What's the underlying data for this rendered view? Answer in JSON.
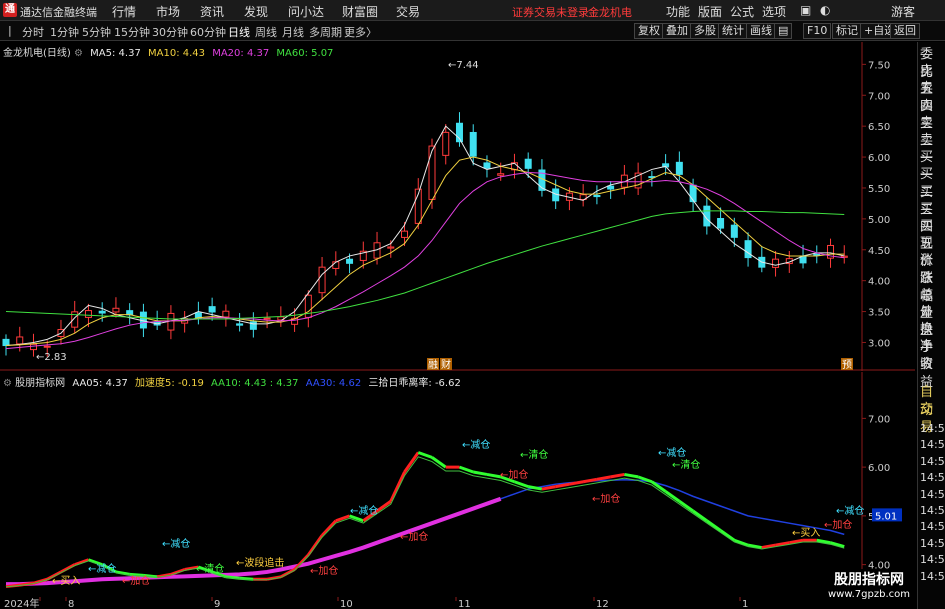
{
  "titlebar": {
    "logo": "通",
    "app_name": "通达信金融终端",
    "menus": [
      "行情",
      "市场",
      "资讯",
      "发现",
      "问小达",
      "财富圈",
      "交易"
    ],
    "notice": "证券交易未登录",
    "stock_label": "金龙机电",
    "right_menus": [
      "功能",
      "版面",
      "公式",
      "选项"
    ],
    "guest": "游客"
  },
  "toolbar": {
    "periods": [
      "分时",
      "1分钟",
      "5分钟",
      "15分钟",
      "30分钟",
      "60分钟",
      "日线",
      "周线",
      "月线",
      "多周期",
      "更多〉"
    ],
    "active_period": "日线",
    "right_buttons": [
      "复权",
      "叠加",
      "多股",
      "统计",
      "画线",
      "F10",
      "标记",
      "+自选",
      "返回"
    ]
  },
  "main": {
    "stock": "金龙机电(日线)",
    "ma": [
      {
        "label": "MA5: 4.37",
        "color": "#e8e8e8"
      },
      {
        "label": "MA10: 4.43",
        "color": "#f0d040"
      },
      {
        "label": "MA20: 4.37",
        "color": "#e040e0"
      },
      {
        "label": "MA60: 5.07",
        "color": "#40e040"
      }
    ],
    "high_label": "7.44",
    "low_label": "2.83",
    "markers": [
      "融",
      "财",
      "预"
    ],
    "y_ticks": [
      "7.50",
      "7.00",
      "6.50",
      "6.00",
      "5.50",
      "5.00",
      "4.50",
      "4.00",
      "3.50",
      "3.00"
    ]
  },
  "indicator": {
    "name": "股朋指标网",
    "items": [
      {
        "label": "AA05: 4.37",
        "color": "#e8e8e8"
      },
      {
        "label": "加速度5: -0.19",
        "color": "#f0d040"
      },
      {
        "label": "AA10: 4.43 : 4.37",
        "color": "#40e040"
      },
      {
        "label": "AA30: 4.62",
        "color": "#3050ff"
      },
      {
        "label": "三拾日乖离率: -6.62",
        "color": "#e8e8e8"
      }
    ],
    "y_ticks": [
      "7.00",
      "6.00",
      "5.00",
      "4.00"
    ],
    "current_value": "5.01",
    "signals": [
      "减仓",
      "清仓",
      "加仓",
      "买入",
      "波段追击"
    ]
  },
  "xaxis": {
    "labels": [
      "2024年",
      "8",
      "9",
      "10",
      "11",
      "12",
      "1"
    ]
  },
  "right_panel": {
    "items": [
      "委比",
      "卖五",
      "卖四",
      "卖三",
      "卖二",
      "卖一",
      "买一",
      "买二",
      "买三",
      "买四",
      "买五",
      "现价",
      "涨跌",
      "涨幅",
      "总量",
      "外盘",
      "换手",
      "净资",
      "收益"
    ],
    "lower_items": [
      "自动",
      "交易"
    ],
    "times": [
      "14:56",
      "14:56",
      "14:56",
      "14:56",
      "14:56",
      "14:56",
      "14:56",
      "14:56",
      "14:56",
      "14:56"
    ]
  },
  "watermark": {
    "line1": "股朋指标网",
    "line2": "www.7gpzb.com"
  },
  "chart_data": [
    {
      "type": "candlestick",
      "title": "金龙机电(日线)",
      "ylim": [
        2.7,
        7.7
      ],
      "y_ticks": [
        3.0,
        3.5,
        4.0,
        4.5,
        5.0,
        5.5,
        6.0,
        6.5,
        7.0,
        7.5
      ],
      "series": [
        {
          "name": "MA5",
          "values": [
            2.95,
            2.97,
            3.0,
            3.05,
            3.15,
            3.4,
            3.6,
            3.55,
            3.45,
            3.4,
            3.35,
            3.3,
            3.35,
            3.4,
            3.5,
            3.45,
            3.4,
            3.35,
            3.3,
            3.3,
            3.35,
            3.5,
            3.8,
            4.1,
            4.3,
            4.4,
            4.45,
            4.5,
            4.6,
            4.9,
            5.4,
            6.1,
            6.5,
            6.3,
            5.9,
            5.8,
            5.85,
            5.9,
            5.7,
            5.5,
            5.4,
            5.35,
            5.3,
            5.45,
            5.55,
            5.6,
            5.7,
            5.8,
            5.85,
            5.6,
            5.3,
            5.0,
            4.8,
            4.6,
            4.45,
            4.3,
            4.25,
            4.3,
            4.4,
            4.45,
            4.45,
            4.4
          ]
        },
        {
          "name": "MA10",
          "values": [
            2.95,
            2.96,
            2.98,
            3.0,
            3.05,
            3.15,
            3.3,
            3.4,
            3.45,
            3.45,
            3.4,
            3.35,
            3.35,
            3.35,
            3.4,
            3.42,
            3.4,
            3.38,
            3.35,
            3.33,
            3.33,
            3.38,
            3.5,
            3.7,
            3.9,
            4.1,
            4.25,
            4.35,
            4.45,
            4.6,
            4.9,
            5.3,
            5.7,
            5.95,
            6.0,
            5.95,
            5.85,
            5.8,
            5.75,
            5.65,
            5.55,
            5.45,
            5.4,
            5.4,
            5.45,
            5.5,
            5.55,
            5.65,
            5.75,
            5.7,
            5.55,
            5.35,
            5.15,
            4.95,
            4.75,
            4.55,
            4.45,
            4.4,
            4.4,
            4.4,
            4.43,
            4.43
          ]
        },
        {
          "name": "MA20",
          "values": [
            2.9,
            2.92,
            2.94,
            2.96,
            2.98,
            3.02,
            3.08,
            3.15,
            3.22,
            3.28,
            3.32,
            3.34,
            3.35,
            3.36,
            3.38,
            3.4,
            3.4,
            3.39,
            3.38,
            3.36,
            3.35,
            3.36,
            3.4,
            3.48,
            3.58,
            3.7,
            3.82,
            3.95,
            4.08,
            4.22,
            4.4,
            4.65,
            4.95,
            5.25,
            5.45,
            5.6,
            5.68,
            5.72,
            5.75,
            5.74,
            5.7,
            5.66,
            5.62,
            5.6,
            5.6,
            5.6,
            5.6,
            5.6,
            5.62,
            5.6,
            5.55,
            5.48,
            5.38,
            5.25,
            5.1,
            4.95,
            4.8,
            4.65,
            4.52,
            4.45,
            4.4,
            4.37
          ]
        },
        {
          "name": "MA60",
          "values": [
            3.5,
            3.49,
            3.48,
            3.47,
            3.46,
            3.45,
            3.44,
            3.43,
            3.42,
            3.41,
            3.4,
            3.39,
            3.38,
            3.38,
            3.38,
            3.38,
            3.38,
            3.39,
            3.4,
            3.41,
            3.42,
            3.44,
            3.47,
            3.5,
            3.54,
            3.58,
            3.63,
            3.68,
            3.74,
            3.8,
            3.88,
            3.96,
            4.04,
            4.12,
            4.2,
            4.28,
            4.35,
            4.42,
            4.49,
            4.56,
            4.62,
            4.68,
            4.74,
            4.8,
            4.86,
            4.92,
            4.98,
            5.04,
            5.08,
            5.1,
            5.12,
            5.13,
            5.13,
            5.13,
            5.12,
            5.12,
            5.11,
            5.1,
            5.1,
            5.09,
            5.08,
            5.07
          ]
        }
      ]
    },
    {
      "type": "line",
      "title": "股朋指标网",
      "ylim": [
        3.5,
        7.5
      ],
      "y_ticks": [
        4.0,
        5.0,
        6.0,
        7.0
      ],
      "series": [
        {
          "name": "AA05",
          "values": [
            3.55,
            3.58,
            3.62,
            3.7,
            3.85,
            4.0,
            4.1,
            4.0,
            3.85,
            3.8,
            3.78,
            3.75,
            3.8,
            3.9,
            3.95,
            3.85,
            3.75,
            3.72,
            3.7,
            3.7,
            3.75,
            3.9,
            4.2,
            4.6,
            4.9,
            5.0,
            4.9,
            5.1,
            5.3,
            5.9,
            6.3,
            6.2,
            6.0,
            6.0,
            5.9,
            5.85,
            5.8,
            5.7,
            5.6,
            5.55,
            5.6,
            5.65,
            5.7,
            5.75,
            5.8,
            5.85,
            5.8,
            5.7,
            5.5,
            5.3,
            5.1,
            4.9,
            4.7,
            4.5,
            4.4,
            4.35,
            4.4,
            4.45,
            4.5,
            4.5,
            4.45,
            4.37
          ]
        },
        {
          "name": "AA30",
          "values": [
            3.6,
            3.6,
            3.61,
            3.62,
            3.64,
            3.66,
            3.68,
            3.7,
            3.71,
            3.72,
            3.73,
            3.74,
            3.75,
            3.76,
            3.77,
            3.78,
            3.79,
            3.8,
            3.82,
            3.85,
            3.9,
            3.96,
            4.02,
            4.1,
            4.18,
            4.26,
            4.35,
            4.45,
            4.55,
            4.65,
            4.75,
            4.85,
            4.95,
            5.05,
            5.15,
            5.25,
            5.35,
            5.45,
            5.55,
            5.6,
            5.65,
            5.68,
            5.7,
            5.72,
            5.73,
            5.74,
            5.73,
            5.7,
            5.62,
            5.52,
            5.4,
            5.3,
            5.2,
            5.1,
            5.0,
            4.95,
            4.9,
            4.85,
            4.8,
            4.75,
            4.7,
            4.62
          ]
        }
      ]
    }
  ]
}
